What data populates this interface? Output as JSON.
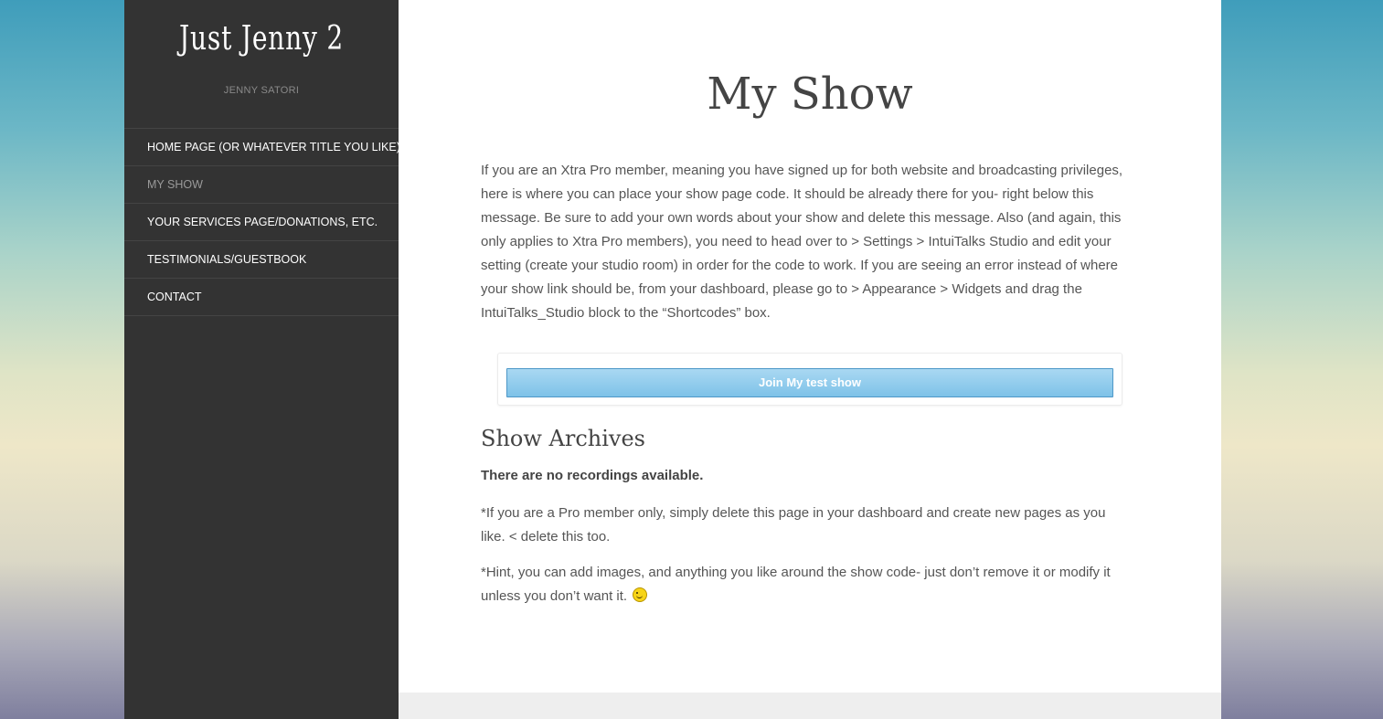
{
  "site": {
    "title": "Just Jenny 2",
    "subtitle": "JENNY SATORI"
  },
  "nav": {
    "items": [
      {
        "label": "HOME PAGE (OR WHATEVER TITLE YOU LIKE)",
        "active": false
      },
      {
        "label": "MY SHOW",
        "active": true
      },
      {
        "label": "YOUR SERVICES PAGE/DONATIONS, ETC.",
        "active": false
      },
      {
        "label": "TESTIMONIALS/GUESTBOOK",
        "active": false
      },
      {
        "label": "CONTACT",
        "active": false
      }
    ]
  },
  "page": {
    "title": "My Show",
    "intro": "If you are an Xtra Pro member, meaning you have signed up for both website and broadcasting privileges, here is where you can place your show page code. It should be already there for you- right below this message. Be sure to add your own words about your show and delete this message. Also (and again, this only applies to Xtra Pro members), you need to head over to > Settings > IntuiTalks Studio and edit your setting (create your studio room) in order for the code to work. If you are seeing an error instead of where your show link should be, from your dashboard, please go to > Appearance > Widgets and drag the IntuiTalks_Studio block to the “Shortcodes” box.",
    "join_button": "Join My test show",
    "archives_title": "Show Archives",
    "no_recordings": "There are no recordings available.",
    "note1": "*If you are a Pro member only, simply delete this page in your dashboard and create new pages as you like. < delete this too.",
    "note2": "*Hint, you can add images, and anything you like around the show code- just don’t remove it or modify it unless you don’t want it.",
    "emoji_icon": "wink-smiley-icon"
  },
  "colors": {
    "sidebar_bg": "#333333",
    "content_bg": "#ffffff",
    "button_blue": "#8ccaea",
    "text": "#555555"
  }
}
